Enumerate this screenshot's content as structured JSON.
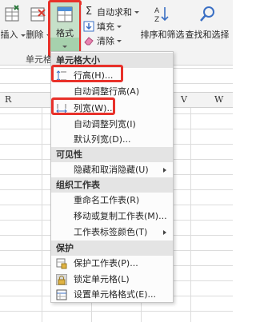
{
  "ribbon": {
    "insert_label": "插入",
    "delete_label": "删除",
    "format_label": "格式",
    "cells_group_label": "单元格",
    "autosum_label": "自动求和",
    "fill_label": "填充",
    "clear_label": "清除",
    "sort_filter_label": "排序和筛选",
    "find_select_label": "查找和选择"
  },
  "columns": [
    "R",
    "S",
    "T",
    "U",
    "V",
    "W"
  ],
  "menu": {
    "sec_cell_size": "单元格大小",
    "row_height": "行高(H)...",
    "autofit_row_height": "自动调整行高(A)",
    "column_width": "列宽(W)...",
    "autofit_column_width": "自动调整列宽(I)",
    "default_width": "默认列宽(D)...",
    "sec_visibility": "可见性",
    "hide_unhide": "隐藏和取消隐藏(U)",
    "sec_organize": "组织工作表",
    "rename_sheet": "重命名工作表(R)",
    "move_copy_sheet": "移动或复制工作表(M)...",
    "tab_color": "工作表标签颜色(T)",
    "sec_protection": "保护",
    "protect_sheet": "保护工作表(P)...",
    "lock_cell": "锁定单元格(L)",
    "format_cells": "设置单元格格式(E)..."
  },
  "colors": {
    "highlight_red": "#e8312a",
    "format_button_bg": "#c6e0c9",
    "section_bg": "#e4e4e4"
  }
}
